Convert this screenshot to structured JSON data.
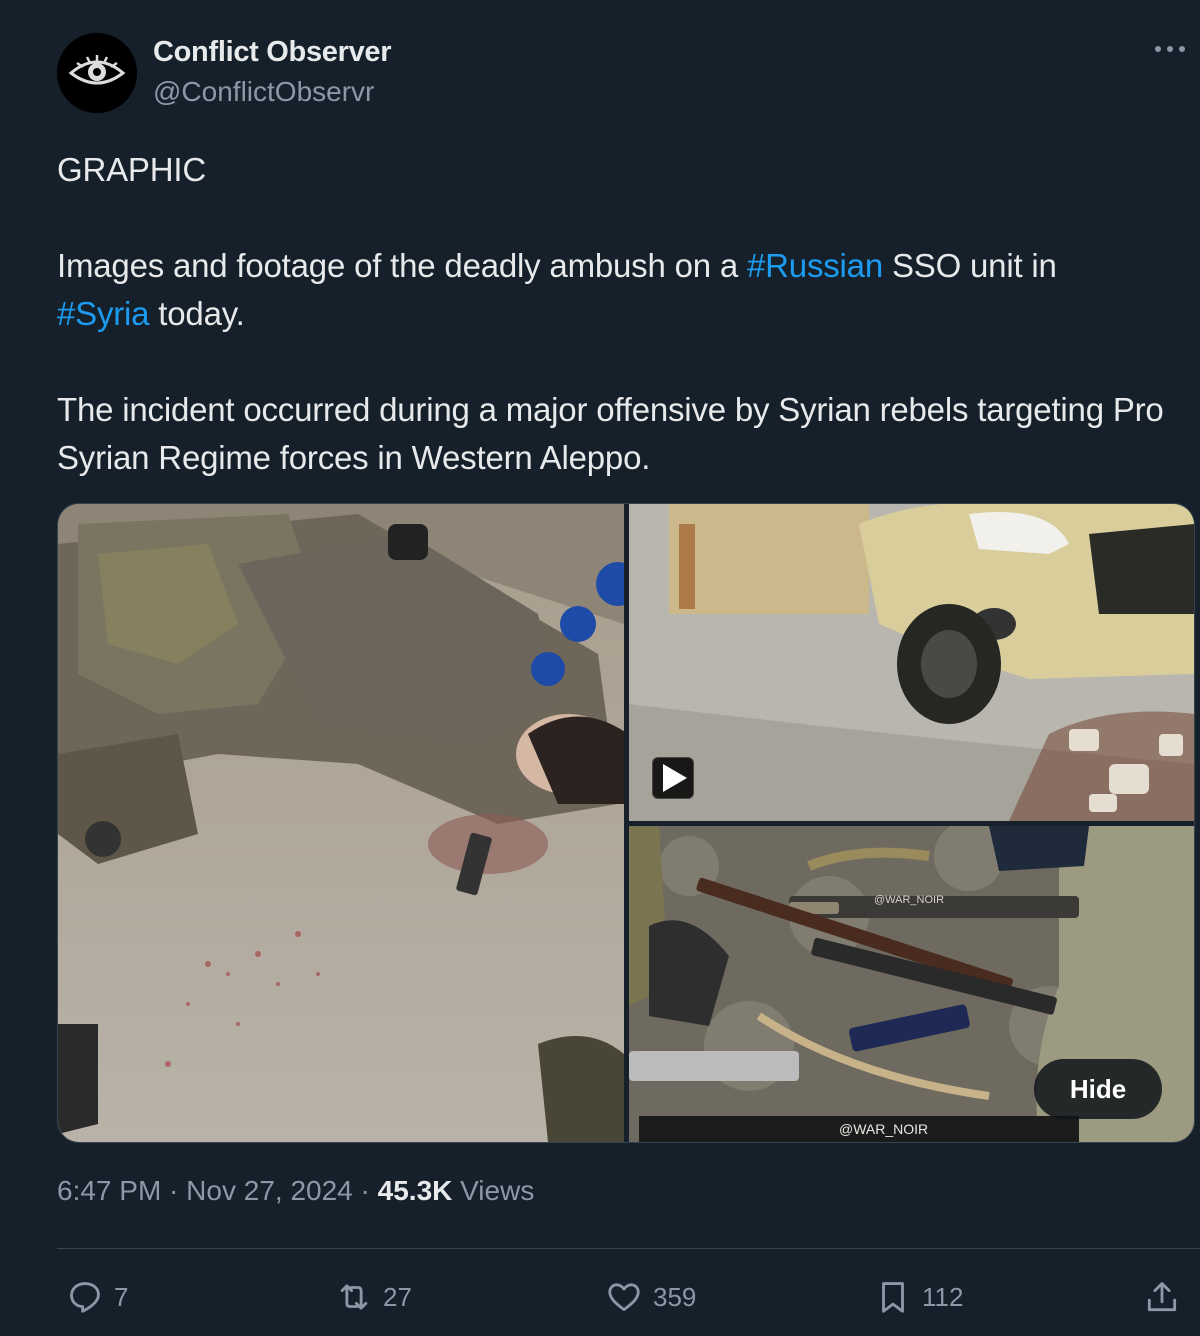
{
  "author": {
    "name": "Conflict Observer",
    "handle": "@ConflictObservr"
  },
  "tweet": {
    "line1": "GRAPHIC",
    "p2_a": "Images and footage of the deadly ambush on a ",
    "p2_tag1": "#Russian",
    "p2_b": " SSO unit in",
    "p2_tag2": "#Syria",
    "p2_c": " today.",
    "p3": "The incident occurred during a major offensive by Syrian rebels targeting Pro Syrian Regime forces in Western Aleppo."
  },
  "media": {
    "watermark_top": "@WAR_NOIR",
    "watermark_bottom": "@WAR_NOIR",
    "hide_label": "Hide"
  },
  "meta": {
    "time": "6:47 PM",
    "sep1": " · ",
    "date": "Nov 27, 2024",
    "sep2": " · ",
    "views_count": "45.3K",
    "views_label": " Views"
  },
  "actions": {
    "replies": "7",
    "reposts": "27",
    "likes": "359",
    "bookmarks": "112"
  },
  "colors": {
    "background": "#15202b",
    "text": "#e7e9ea",
    "secondary": "#8b98a5",
    "link": "#1d9bf0",
    "border": "#38444d"
  }
}
